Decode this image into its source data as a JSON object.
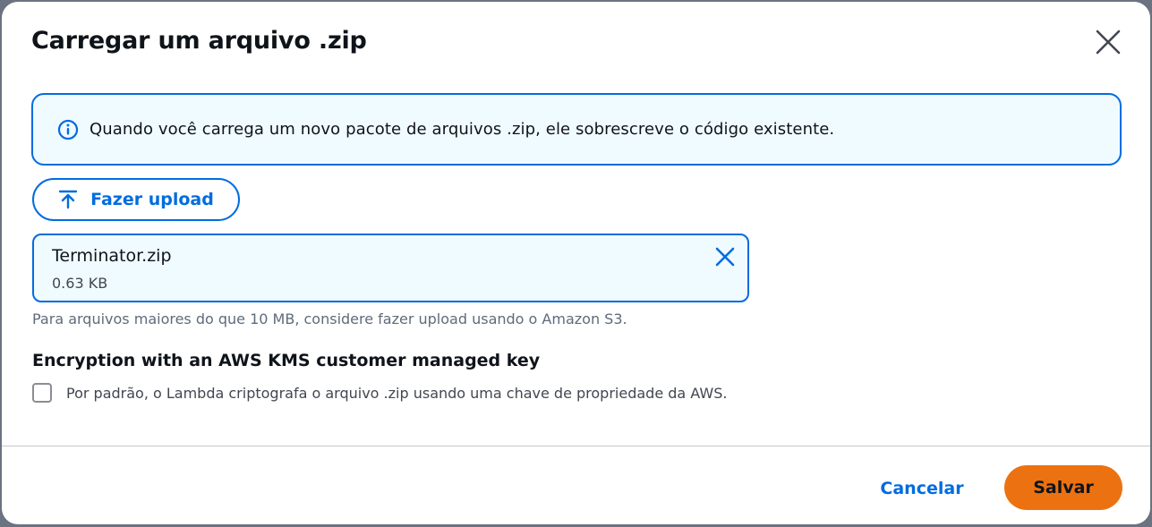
{
  "modal": {
    "title": "Carregar um arquivo .zip",
    "close_icon": "close-icon"
  },
  "alert": {
    "icon": "info-icon",
    "text": "Quando você carrega um novo pacote de arquivos .zip, ele sobrescreve o código existente.",
    "border_color": "#006ce0",
    "background_color": "#f0fbff"
  },
  "upload": {
    "icon": "upload-arrow-icon",
    "label": "Fazer upload"
  },
  "file": {
    "name": "Terminator.zip",
    "size": "0.63 KB",
    "dismiss_icon": "close-icon"
  },
  "hint": "Para arquivos maiores do que 10 MB, considere fazer upload usando o Amazon S3.",
  "encryption": {
    "label": "Encryption with an AWS KMS customer managed key",
    "checkbox_label": "Por padrão, o Lambda criptografa o arquivo .zip usando uma chave de propriedade da AWS.",
    "checked": false
  },
  "footer": {
    "cancel_label": "Cancelar",
    "save_label": "Salvar",
    "accent_color": "#ec7211",
    "link_color": "#006ce0"
  }
}
